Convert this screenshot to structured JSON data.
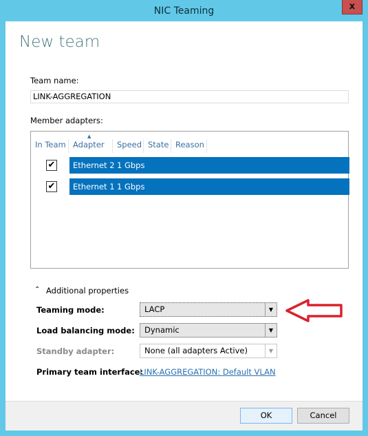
{
  "window": {
    "title": "NIC Teaming",
    "close_label": "x"
  },
  "heading": "New team",
  "team_name": {
    "label": "Team name:",
    "value": "LINK-AGGREGATION"
  },
  "members": {
    "label": "Member adapters:",
    "columns": [
      "In Team",
      "Adapter",
      "Speed",
      "State",
      "Reason"
    ],
    "rows": [
      {
        "checked": true,
        "adapter": "Ethernet 2",
        "speed": "1 Gbps"
      },
      {
        "checked": true,
        "adapter": "Ethernet 1",
        "speed": "1 Gbps"
      }
    ]
  },
  "additional": {
    "label": "Additional properties",
    "teaming_mode": {
      "label": "Teaming mode:",
      "value": "LACP"
    },
    "load_balancing": {
      "label": "Load balancing mode:",
      "value": "Dynamic"
    },
    "standby": {
      "label": "Standby adapter:",
      "value": "None (all adapters Active)"
    },
    "primary": {
      "label": "Primary team interface:",
      "link": "LINK-AGGREGATION: Default VLAN"
    }
  },
  "buttons": {
    "ok": "OK",
    "cancel": "Cancel"
  },
  "colors": {
    "accent": "#62c8e8",
    "selection": "#0572bd",
    "annotation_arrow": "#d9232e"
  }
}
